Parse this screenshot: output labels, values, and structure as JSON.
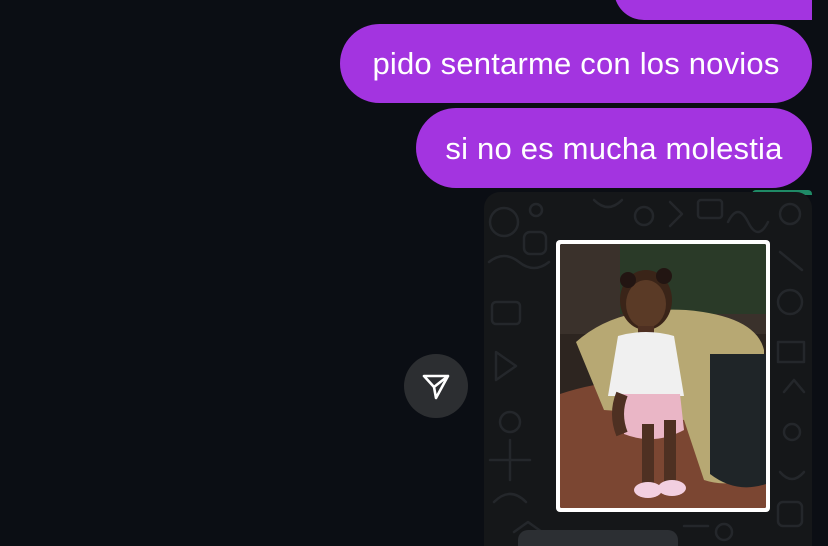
{
  "messages": [
    {
      "text": ""
    },
    {
      "text": "pido sentarme con los novios"
    },
    {
      "text": "si no es mucha molestia"
    }
  ],
  "shared_post": {
    "image_alt": "photo of a child sitting on a sofa"
  },
  "share_button": {
    "icon": "send-icon"
  },
  "colors": {
    "background": "#0b0e14",
    "bubble": "#a334e0",
    "bubble_text": "#ffffff",
    "card_background": "#151719",
    "share_button_background": "#2c2e31"
  }
}
